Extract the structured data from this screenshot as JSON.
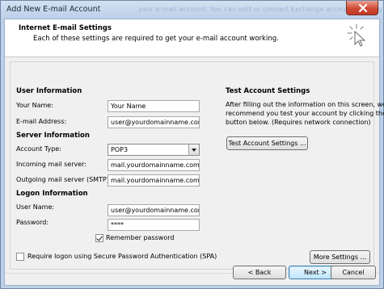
{
  "window": {
    "title": "Add New E-mail Account",
    "ghost_text": "your e-mail account. You can edit or convert Exchange accounts setting up"
  },
  "header": {
    "title": "Internet E-mail Settings",
    "subtitle": "Each of these settings are required to get your e-mail account working."
  },
  "user_info": {
    "heading": "User Information",
    "name_label": "Your Name:",
    "name_value": "Your Name",
    "email_label": "E-mail Address:",
    "email_value": "user@yourdomainname.com"
  },
  "server_info": {
    "heading": "Server Information",
    "account_type_label": "Account Type:",
    "account_type_value": "POP3",
    "incoming_label": "Incoming mail server:",
    "incoming_value": "mail.yourdomainname.com",
    "outgoing_label": "Outgoing mail server (SMTP):",
    "outgoing_value": "mail.yourdomainname.com"
  },
  "logon_info": {
    "heading": "Logon Information",
    "username_label": "User Name:",
    "username_value": "user@yourdomainname.com",
    "password_label": "Password:",
    "password_value": "****",
    "remember_label": "Remember password",
    "remember_checked": true,
    "spa_label": "Require logon using Secure Password Authentication (SPA)",
    "spa_checked": false
  },
  "test_settings": {
    "heading": "Test Account Settings",
    "description_line1": "After filling out the information on this screen, we",
    "description_line2": "recommend you test your account by clicking the",
    "description_line3": "button below.  (Requires network connection)",
    "button_label": "Test Account Settings ..."
  },
  "buttons": {
    "more_settings": "More Settings ...",
    "back": "< Back",
    "next": "Next >",
    "cancel": "Cancel"
  },
  "colors": {
    "frame": "#bcd0e8",
    "close_button": "#cf4b36",
    "focus_border": "#3c7fb1"
  },
  "icons": {
    "header": "sparkle-cursor-icon",
    "close": "close-icon",
    "dropdown": "chevron-down-icon"
  }
}
